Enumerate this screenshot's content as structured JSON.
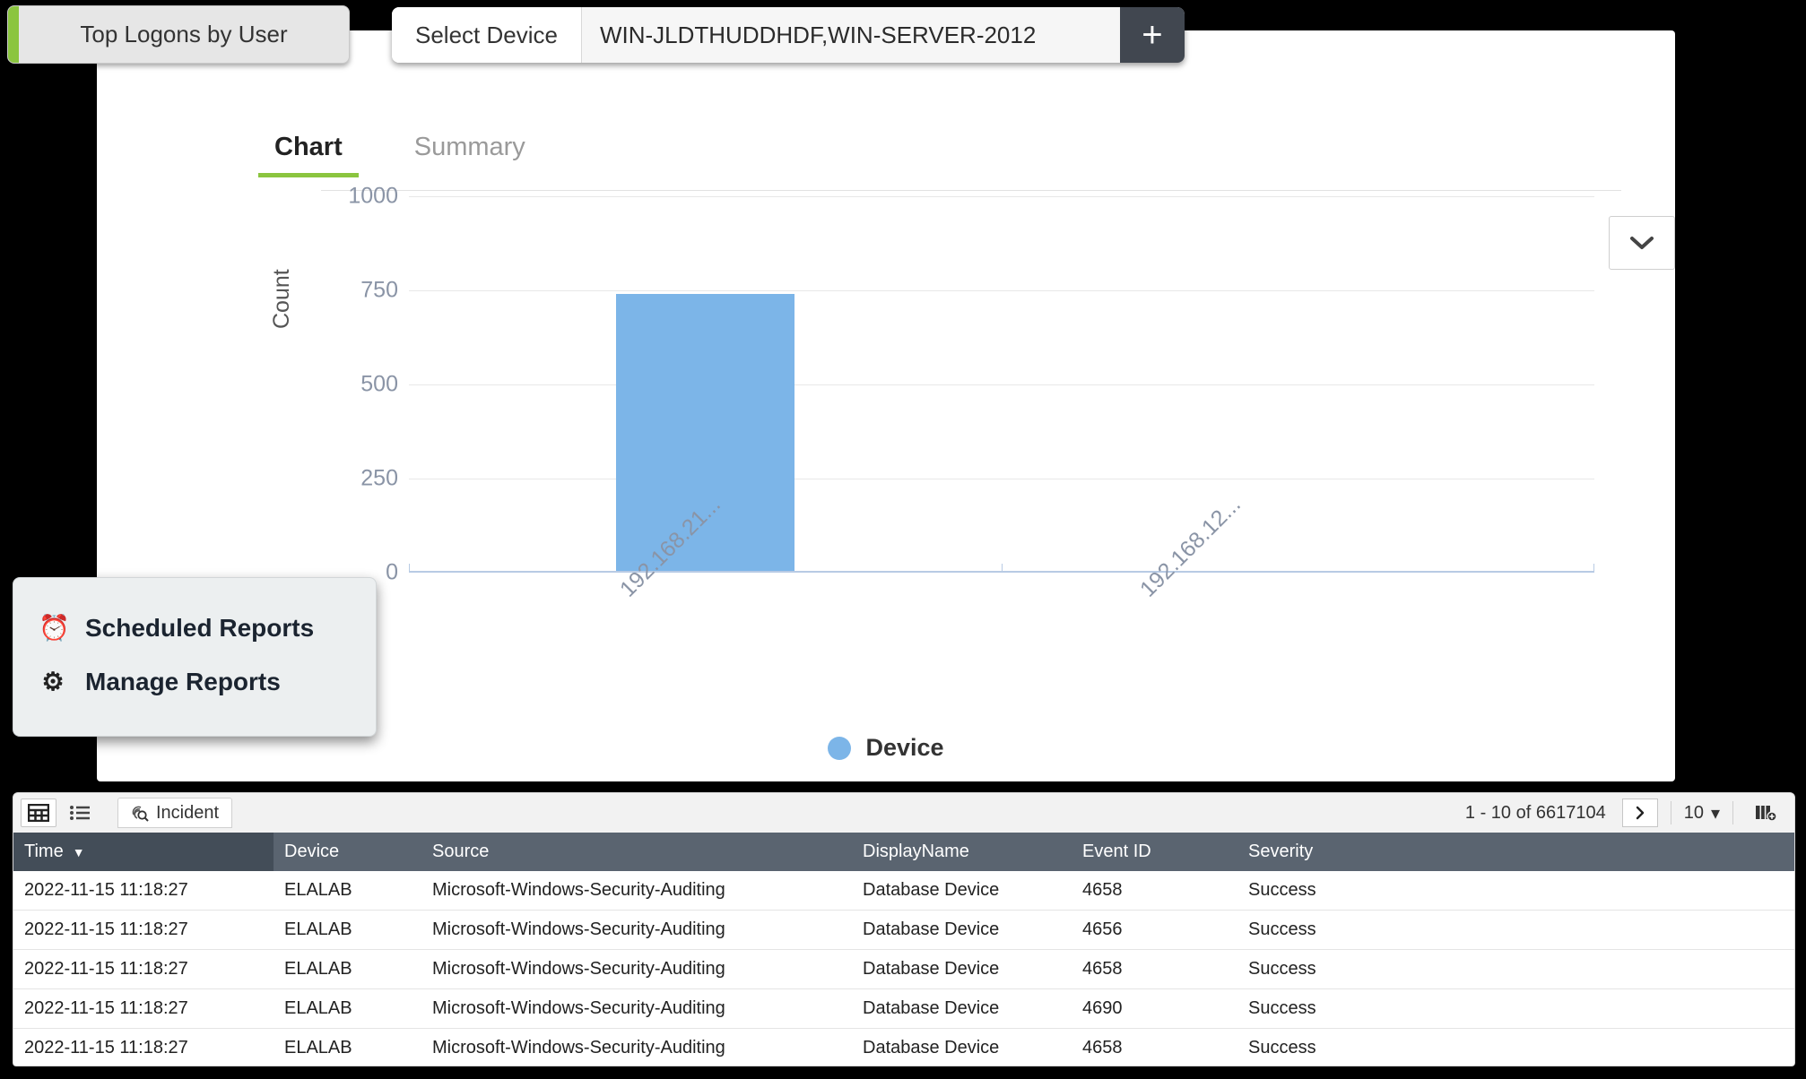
{
  "report_tab": {
    "label": "Top Logons by User",
    "accent_color": "#8bc53f"
  },
  "device_selector": {
    "select_label": "Select Device",
    "value": "WIN-JLDTHUDDHDF,WIN-SERVER-2012",
    "add_label": "+"
  },
  "chart_tabs": [
    {
      "label": "Chart",
      "active": true
    },
    {
      "label": "Summary",
      "active": false
    }
  ],
  "collapse_icon": "chevron-down-icon",
  "chart_data": {
    "type": "bar",
    "title": "",
    "xlabel": "",
    "ylabel": "Count",
    "categories": [
      "192.168.21...",
      "192.168.12..."
    ],
    "values": [
      735,
      0
    ],
    "ylim": [
      0,
      1000
    ],
    "yticks": [
      1000,
      750,
      500,
      250,
      0
    ],
    "grid": true,
    "legend": {
      "position": "bottom",
      "entries": [
        {
          "name": "Device",
          "color": "#7cb5e8"
        }
      ]
    },
    "series": [
      {
        "name": "Device",
        "values": [
          735,
          0
        ],
        "color": "#7cb5e8"
      }
    ]
  },
  "reports_menu": {
    "items": [
      {
        "icon": "alarm-clock-icon",
        "glyph": "⏰",
        "label": "Scheduled Reports"
      },
      {
        "icon": "gear-icon",
        "glyph": "⚙",
        "label": "Manage Reports"
      }
    ]
  },
  "grid_toolbar": {
    "grid_view_icon": "grid-view-icon",
    "list_view_icon": "list-view-icon",
    "tab": {
      "icon": "fingerprint-search-icon",
      "label": "Incident"
    },
    "page_info": "1 - 10 of 6617104",
    "next_page_icon": "chevron-right-icon",
    "page_size": "10",
    "page_size_caret": "▾",
    "columns_icon": "add-column-icon"
  },
  "grid": {
    "columns": [
      {
        "key": "time",
        "label": "Time",
        "sorted": true,
        "sort_caret": "▼"
      },
      {
        "key": "device",
        "label": "Device",
        "sorted": false
      },
      {
        "key": "source",
        "label": "Source",
        "sorted": false
      },
      {
        "key": "displayname",
        "label": "DisplayName",
        "sorted": false
      },
      {
        "key": "eventid",
        "label": "Event ID",
        "sorted": false
      },
      {
        "key": "severity",
        "label": "Severity",
        "sorted": false
      }
    ],
    "rows": [
      [
        "2022-11-15 11:18:27",
        "ELALAB",
        "Microsoft-Windows-Security-Auditing",
        "Database Device",
        "4658",
        "Success"
      ],
      [
        "2022-11-15 11:18:27",
        "ELALAB",
        "Microsoft-Windows-Security-Auditing",
        "Database Device",
        "4656",
        "Success"
      ],
      [
        "2022-11-15 11:18:27",
        "ELALAB",
        "Microsoft-Windows-Security-Auditing",
        "Database Device",
        "4658",
        "Success"
      ],
      [
        "2022-11-15 11:18:27",
        "ELALAB",
        "Microsoft-Windows-Security-Auditing",
        "Database Device",
        "4690",
        "Success"
      ],
      [
        "2022-11-15 11:18:27",
        "ELALAB",
        "Microsoft-Windows-Security-Auditing",
        "Database Device",
        "4658",
        "Success"
      ]
    ]
  }
}
